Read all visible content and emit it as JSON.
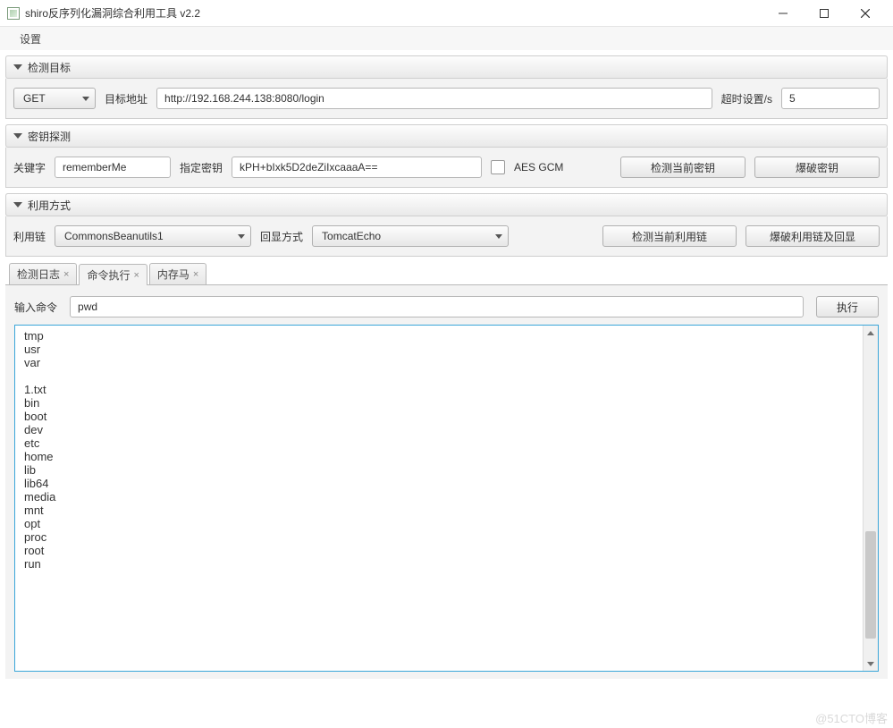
{
  "window": {
    "title": "shiro反序列化漏洞综合利用工具 v2.2"
  },
  "menubar": {
    "settings": "设置"
  },
  "panels": {
    "target": {
      "title": "检测目标",
      "method": "GET",
      "url_label": "目标地址",
      "url": "http://192.168.244.138:8080/login",
      "timeout_label": "超时设置/s",
      "timeout": "5"
    },
    "key": {
      "title": "密钥探测",
      "keyword_label": "关键字",
      "keyword": "rememberMe",
      "specified_key_label": "指定密钥",
      "specified_key": "kPH+bIxk5D2deZiIxcaaaA==",
      "aes_gcm_label": "AES GCM",
      "detect_key_btn": "检测当前密钥",
      "brute_key_btn": "爆破密钥"
    },
    "exploit": {
      "title": "利用方式",
      "chain_label": "利用链",
      "chain": "CommonsBeanutils1",
      "echo_label": "回显方式",
      "echo": "TomcatEcho",
      "detect_chain_btn": "检测当前利用链",
      "brute_chain_btn": "爆破利用链及回显"
    }
  },
  "tabs": {
    "log": "检测日志",
    "cmd": "命令执行",
    "mem": "内存马"
  },
  "cmd": {
    "input_label": "输入命令",
    "input_value": "pwd",
    "exec_btn": "执行",
    "output": "tmp\nusr\nvar\n\n1.txt\nbin\nboot\ndev\netc\nhome\nlib\nlib64\nmedia\nmnt\nopt\nproc\nroot\nrun"
  },
  "watermark": "@51CTO博客"
}
